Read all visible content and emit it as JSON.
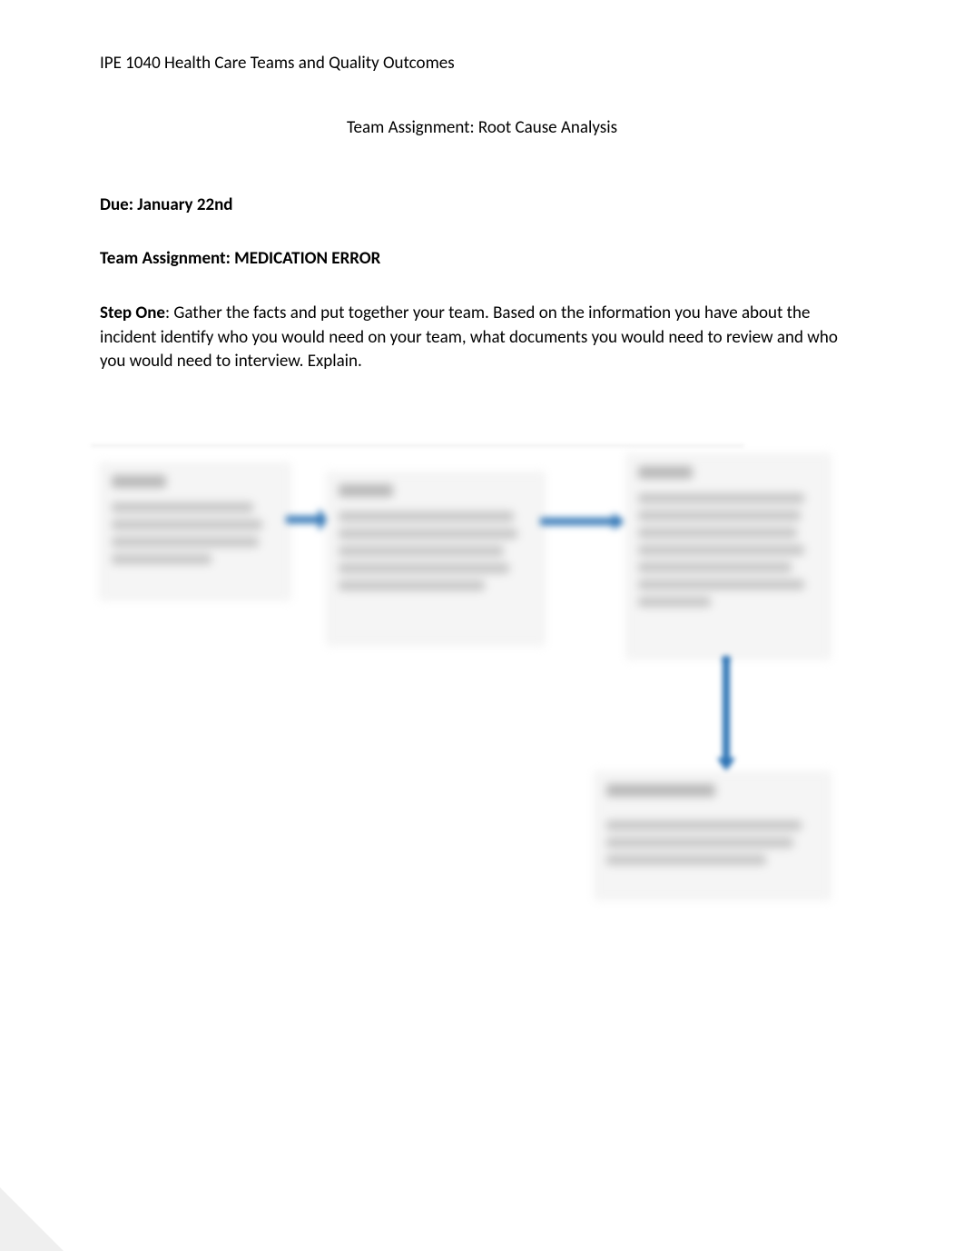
{
  "header": {
    "course": "IPE 1040 Health Care Teams and Quality Outcomes"
  },
  "title": "Team Assignment: Root Cause Analysis",
  "due": "Due: January 22nd",
  "assignment_title": "Team Assignment:  MEDICATION ERROR",
  "step_one": {
    "label": "Step One",
    "text": ": Gather the facts and put together your team. Based on the information you have about the incident identify who you would need on your team, what documents you would need to review and who you would need to interview. Explain."
  },
  "diagram": {
    "boxes": [
      {
        "id": "box1",
        "heading_present": true,
        "line_count": 4
      },
      {
        "id": "box2",
        "heading_present": true,
        "line_count": 5
      },
      {
        "id": "box3",
        "heading_present": true,
        "line_count": 7
      },
      {
        "id": "box4",
        "heading_present": true,
        "line_count": 3
      }
    ],
    "arrows": [
      {
        "from": "box1",
        "to": "box2",
        "direction": "right"
      },
      {
        "from": "box2",
        "to": "box3",
        "direction": "right"
      },
      {
        "from": "box3",
        "to": "box4",
        "direction": "down"
      }
    ],
    "arrow_color": "#2e74b5"
  }
}
